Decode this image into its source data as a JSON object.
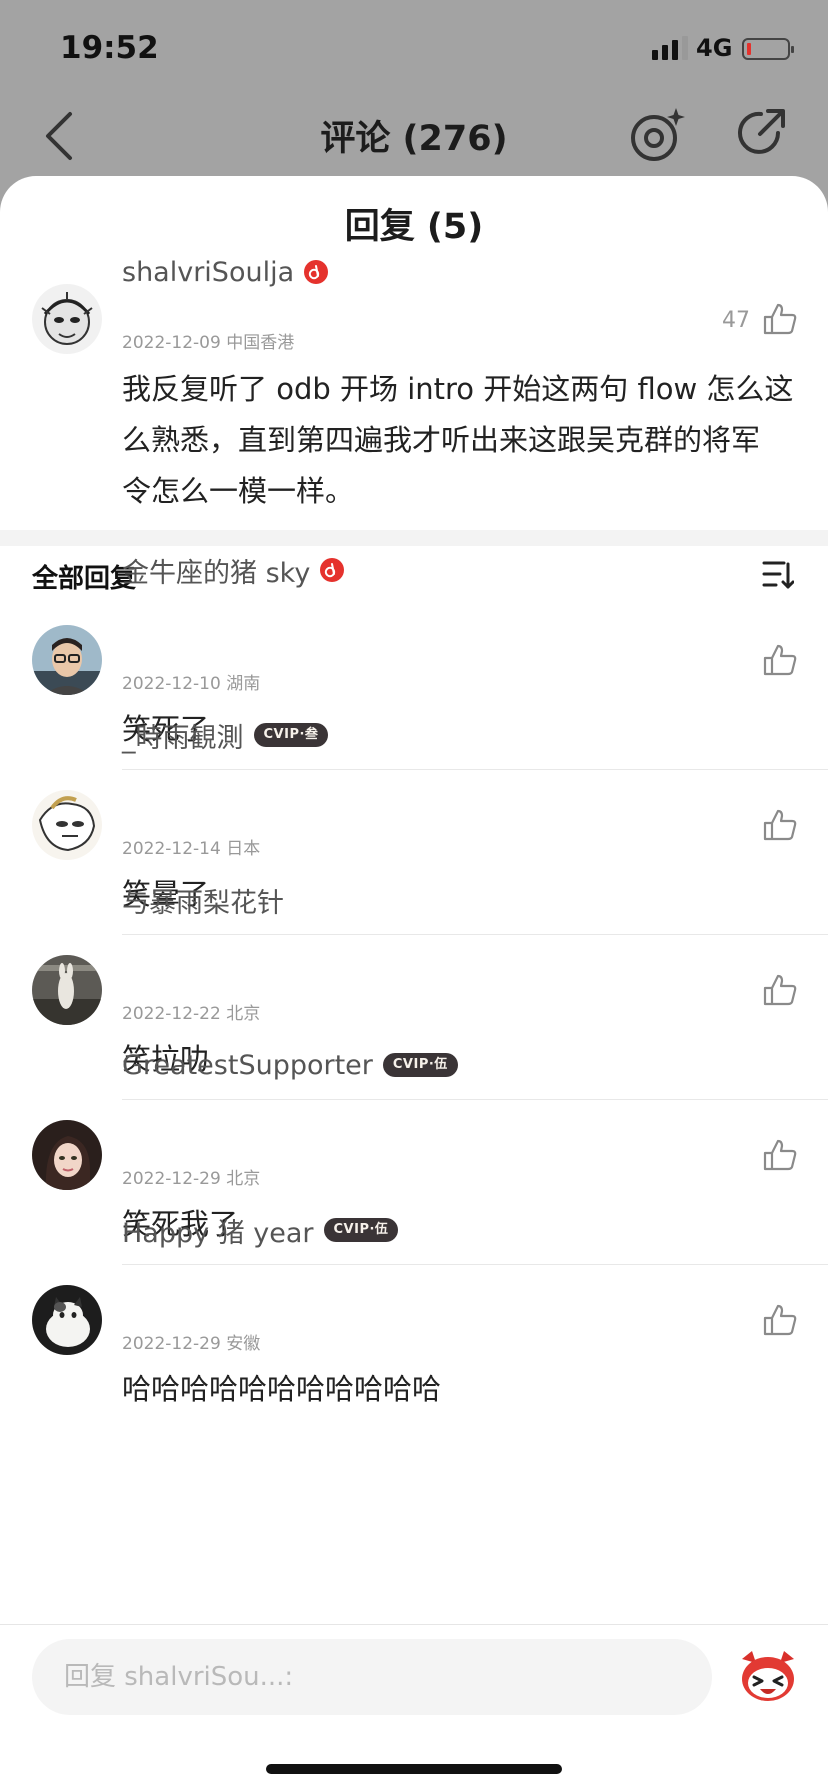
{
  "status_bar": {
    "time": "19:52",
    "network": "4G"
  },
  "nav": {
    "title": "评论 (276)",
    "icons": [
      "back-icon",
      "record-sparkle-icon",
      "share-icon"
    ]
  },
  "sheet": {
    "title": "回复 (5)"
  },
  "main_comment": {
    "username": "shalvriSoulja",
    "date_location": "2022-12-09 中国香港",
    "likes": "47",
    "text_lines": [
      "我反复听了 odb 开场 intro 开始这两句 flow 怎么这",
      "么熟悉，直到第四遍我才听出来这跟吴克群的将军",
      "令怎么一模一样。"
    ]
  },
  "replies_header": "全部回复",
  "replies": [
    {
      "username": "金牛座的猪 sky",
      "badge": "music",
      "date_location": "2022-12-10 湖南",
      "text": "笑死了"
    },
    {
      "username": "_時雨観測",
      "badge": "vip",
      "vip_label": "CVIP·叁",
      "date_location": "2022-12-14 日本",
      "text": "笑晕了"
    },
    {
      "username": "与暴雨梨花针",
      "badge": "",
      "date_location": "2022-12-22 北京",
      "text": "笑拉叻"
    },
    {
      "username": "GreatestSupporter",
      "badge": "vip",
      "vip_label": "CVIP·伍",
      "date_location": "2022-12-29 北京",
      "text": "笑死我了"
    },
    {
      "username": "Happy 猪 year",
      "badge": "vip",
      "vip_label": "CVIP·伍",
      "date_location": "2022-12-29 安徽",
      "text": "哈哈哈哈哈哈哈哈哈哈哈"
    }
  ],
  "reply_input": {
    "placeholder": "回复 shalvriSou...:"
  },
  "colors": {
    "accent_red": "#e5322d",
    "vip_bg": "#3a3436",
    "sheet_bg": "#ffffff",
    "overlay_bg": "#a3a3a3"
  }
}
